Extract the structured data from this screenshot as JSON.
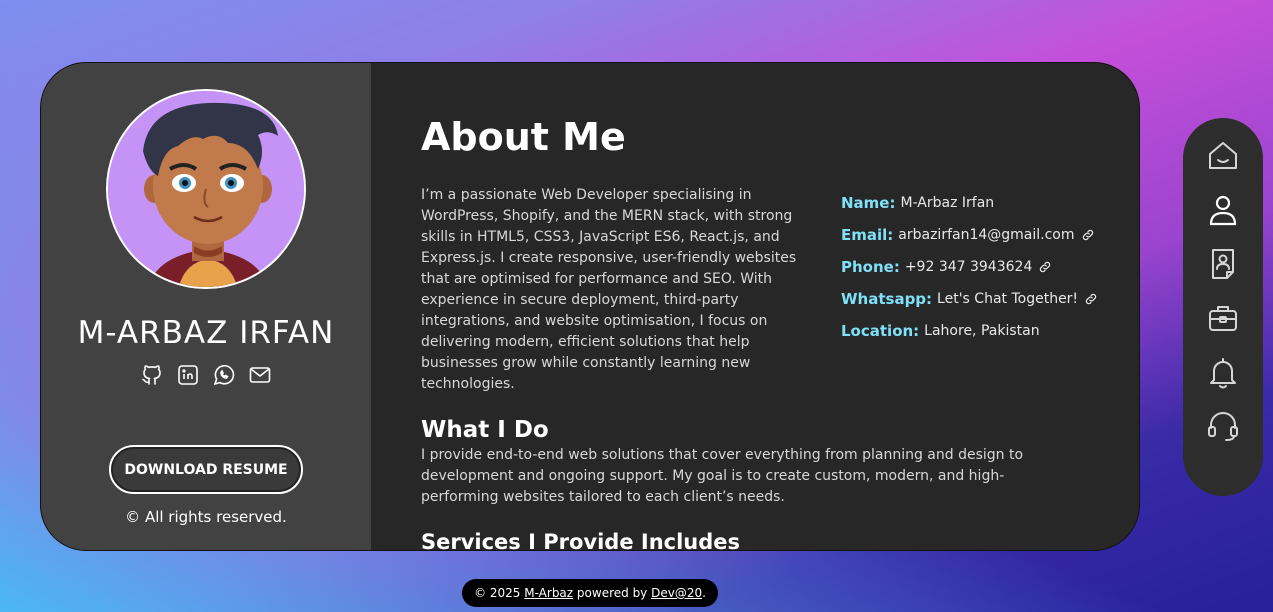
{
  "profile": {
    "name": "M-ARBAZ IRFAN",
    "download_label": "DOWNLOAD RESUME",
    "rights": "© All rights reserved.",
    "socials": [
      "github-icon",
      "linkedin-icon",
      "whatsapp-icon",
      "mail-icon"
    ]
  },
  "about": {
    "title": "About Me",
    "text": "I’m a passionate Web Developer specialising in WordPress, Shopify, and the MERN stack, with strong skills in HTML5, CSS3, JavaScript ES6, React.js, and Express.js. I create responsive, user-friendly websites that are optimised for performance and SEO. With experience in secure deployment, third-party integrations, and website optimisation, I focus on delivering modern, efficient solutions that help businesses grow while constantly learning new technologies.",
    "info": [
      {
        "key": "Name:",
        "value": "M-Arbaz Irfan",
        "link": false
      },
      {
        "key": "Email:",
        "value": "arbazirfan14@gmail.com",
        "link": true
      },
      {
        "key": "Phone:",
        "value": "+92 347 3943624",
        "link": true
      },
      {
        "key": "Whatsapp:",
        "value": "Let's Chat Together!",
        "link": true
      },
      {
        "key": "Location:",
        "value": "Lahore, Pakistan",
        "link": false
      }
    ]
  },
  "what_i_do": {
    "title": "What I Do",
    "text": "I provide end-to-end web solutions that cover everything from planning and design to development and ongoing support. My goal is to create custom, modern, and high-performing websites tailored to each client’s needs."
  },
  "next_section": {
    "title": "Services I Provide Includes"
  },
  "nav": {
    "items": [
      "home-icon",
      "user-icon",
      "contact-card-icon",
      "briefcase-icon",
      "bell-icon",
      "headset-icon"
    ],
    "active": 1
  },
  "footer": {
    "prefix": "© 2025 ",
    "author": "M-Arbaz",
    "middle": " powered by ",
    "brand": "Dev@20",
    "suffix": "."
  },
  "colors": {
    "accent": "#7fe0f7",
    "card": "#272727",
    "sidebar": "#424242",
    "avatar_bg": "#c493f5"
  }
}
